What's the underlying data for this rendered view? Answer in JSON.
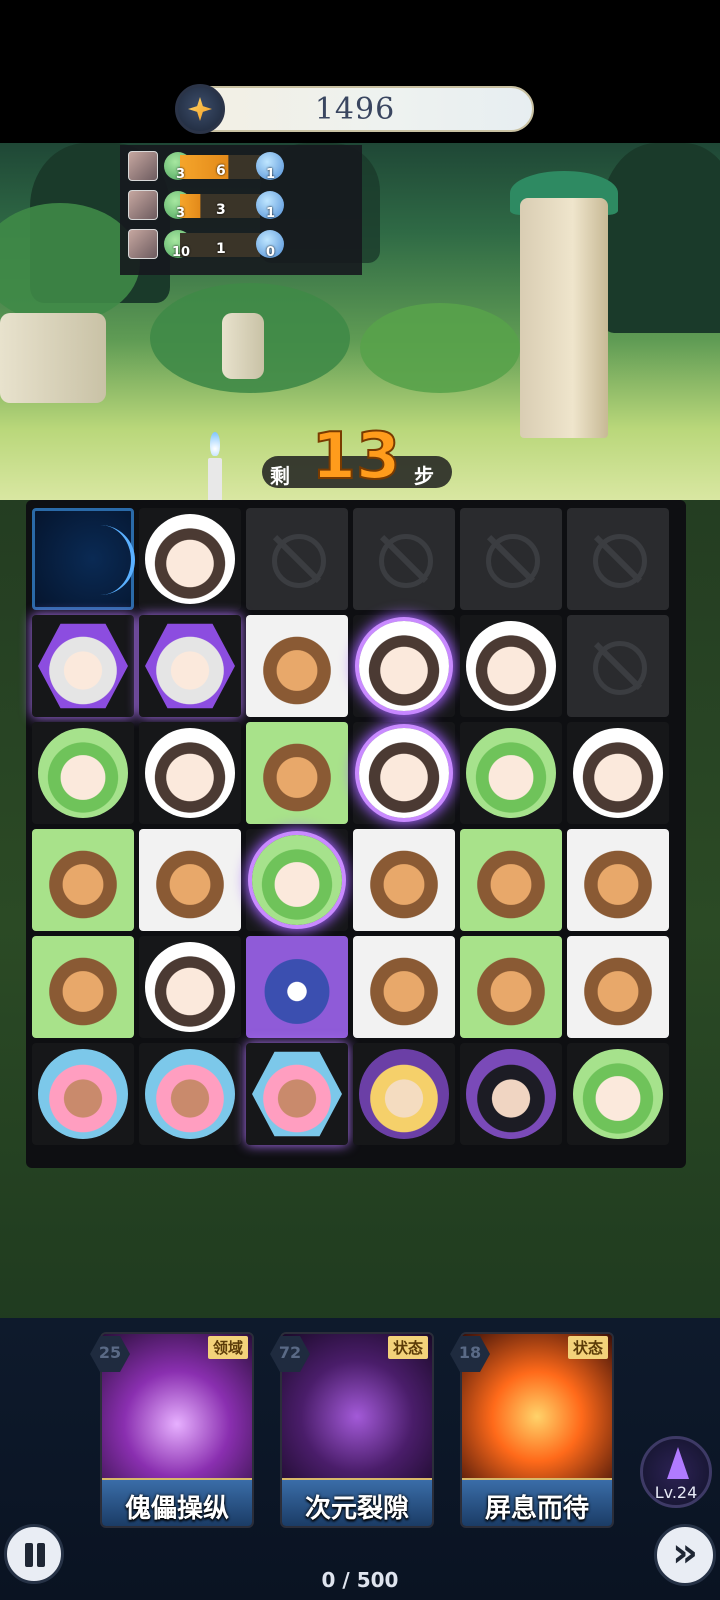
{
  "hud": {
    "score": "1496",
    "score_icon": "star-gem-icon"
  },
  "team": [
    {
      "green": "3",
      "bar_value": "6",
      "blue": "1"
    },
    {
      "green": "3",
      "bar_value": "3",
      "blue": "1"
    },
    {
      "green": "10",
      "bar_value": "1",
      "blue": "0"
    }
  ],
  "steps": {
    "prefix": "剩",
    "count": "13",
    "suffix": "步"
  },
  "board": {
    "rows": [
      [
        "portal",
        "cat",
        "locked",
        "locked",
        "locked",
        "locked"
      ],
      [
        "hood",
        "hood",
        "tiger",
        "cat",
        "cat",
        "locked"
      ],
      [
        "cat-green",
        "cat",
        "tiger",
        "cat",
        "cat-green",
        "cat"
      ],
      [
        "tiger",
        "tiger",
        "cat-green",
        "tiger",
        "tiger",
        "tiger"
      ],
      [
        "tiger",
        "cat",
        "monster",
        "tiger",
        "tiger",
        "tiger"
      ],
      [
        "pink",
        "pink",
        "pink",
        "blonde",
        "ninja",
        "cat-green"
      ]
    ]
  },
  "cards": [
    {
      "cost": "25",
      "tag": "领域",
      "name": "傀儡操纵"
    },
    {
      "cost": "72",
      "tag": "状态",
      "name": "次元裂隙"
    },
    {
      "cost": "18",
      "tag": "状态",
      "name": "屏息而待"
    }
  ],
  "player": {
    "level": "Lv.24"
  },
  "progress": "0 / 500",
  "colors": {
    "accent_orange": "#ff9c1c",
    "glow_purple": "#b476ff",
    "tag_gold": "#f3d27a"
  }
}
